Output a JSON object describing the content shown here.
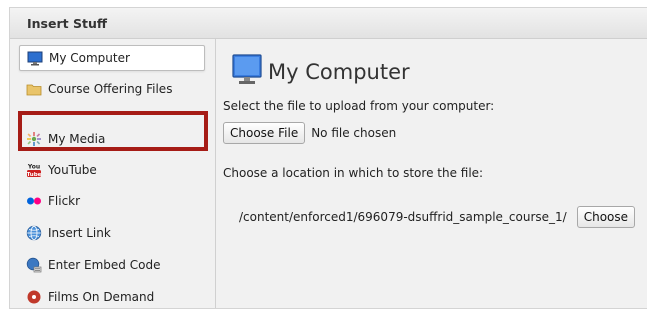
{
  "dialog": {
    "title": "Insert Stuff"
  },
  "sidebar": {
    "items": [
      {
        "label": "My Computer",
        "icon": "monitor-icon",
        "selected": true
      },
      {
        "label": "Course Offering Files",
        "icon": "folder-icon"
      },
      {
        "label": "My Media",
        "icon": "media-icon"
      },
      {
        "label": "YouTube",
        "icon": "youtube-icon"
      },
      {
        "label": "Flickr",
        "icon": "flickr-icon"
      },
      {
        "label": "Insert Link",
        "icon": "globe-icon"
      },
      {
        "label": "Enter Embed Code",
        "icon": "embed-icon"
      },
      {
        "label": "Films On Demand",
        "icon": "films-icon"
      }
    ]
  },
  "main": {
    "heading": "My Computer",
    "select_prompt": "Select the file to upload from your computer:",
    "choose_file_label": "Choose File",
    "no_file_text": "No file chosen",
    "location_prompt": "Choose a location in which to store the file:",
    "path": "/content/enforced1/696079-dsuffrid_sample_course_1/",
    "choose_location_label": "Choose"
  },
  "colors": {
    "highlight": "#a61c16",
    "monitor": "#2c6fcf"
  }
}
